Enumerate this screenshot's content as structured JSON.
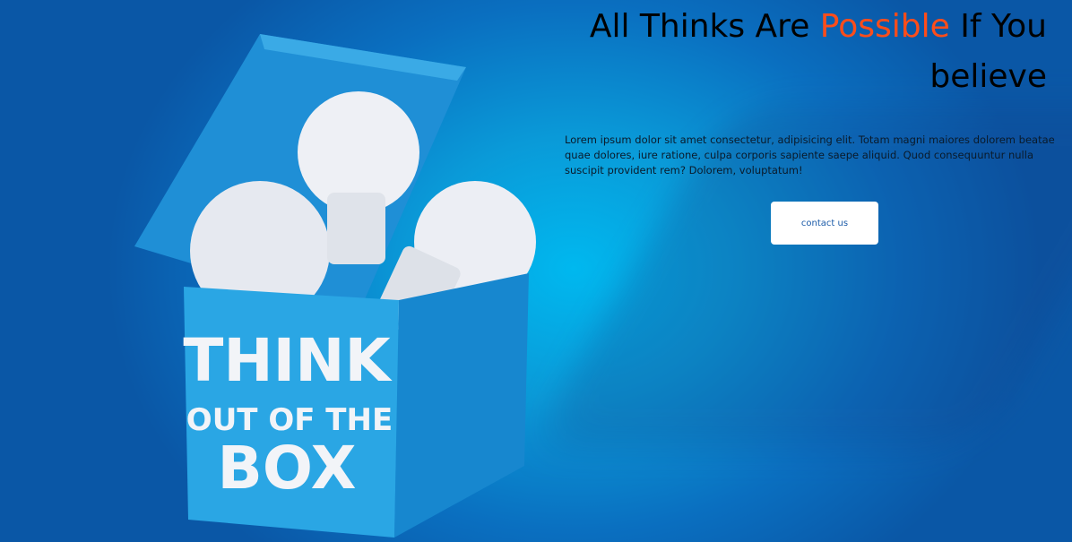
{
  "hero": {
    "title_part1": "All Thinks Are ",
    "title_accent": "Possible",
    "title_part2": " If You believe",
    "description": "Lorem ipsum dolor sit amet consectetur, adipisicing elit. Totam magni maiores dolorem beatae quae dolores, iure ratione, culpa corporis sapiente saepe aliquid. Quod consequuntur nulla suscipit provident rem? Dolorem, voluptatum!",
    "cta_label": "contact us",
    "accent_color": "#ff4d1a"
  },
  "image": {
    "box_line1": "THINK",
    "box_line2": "OUT OF THE",
    "box_line3": "BOX"
  }
}
